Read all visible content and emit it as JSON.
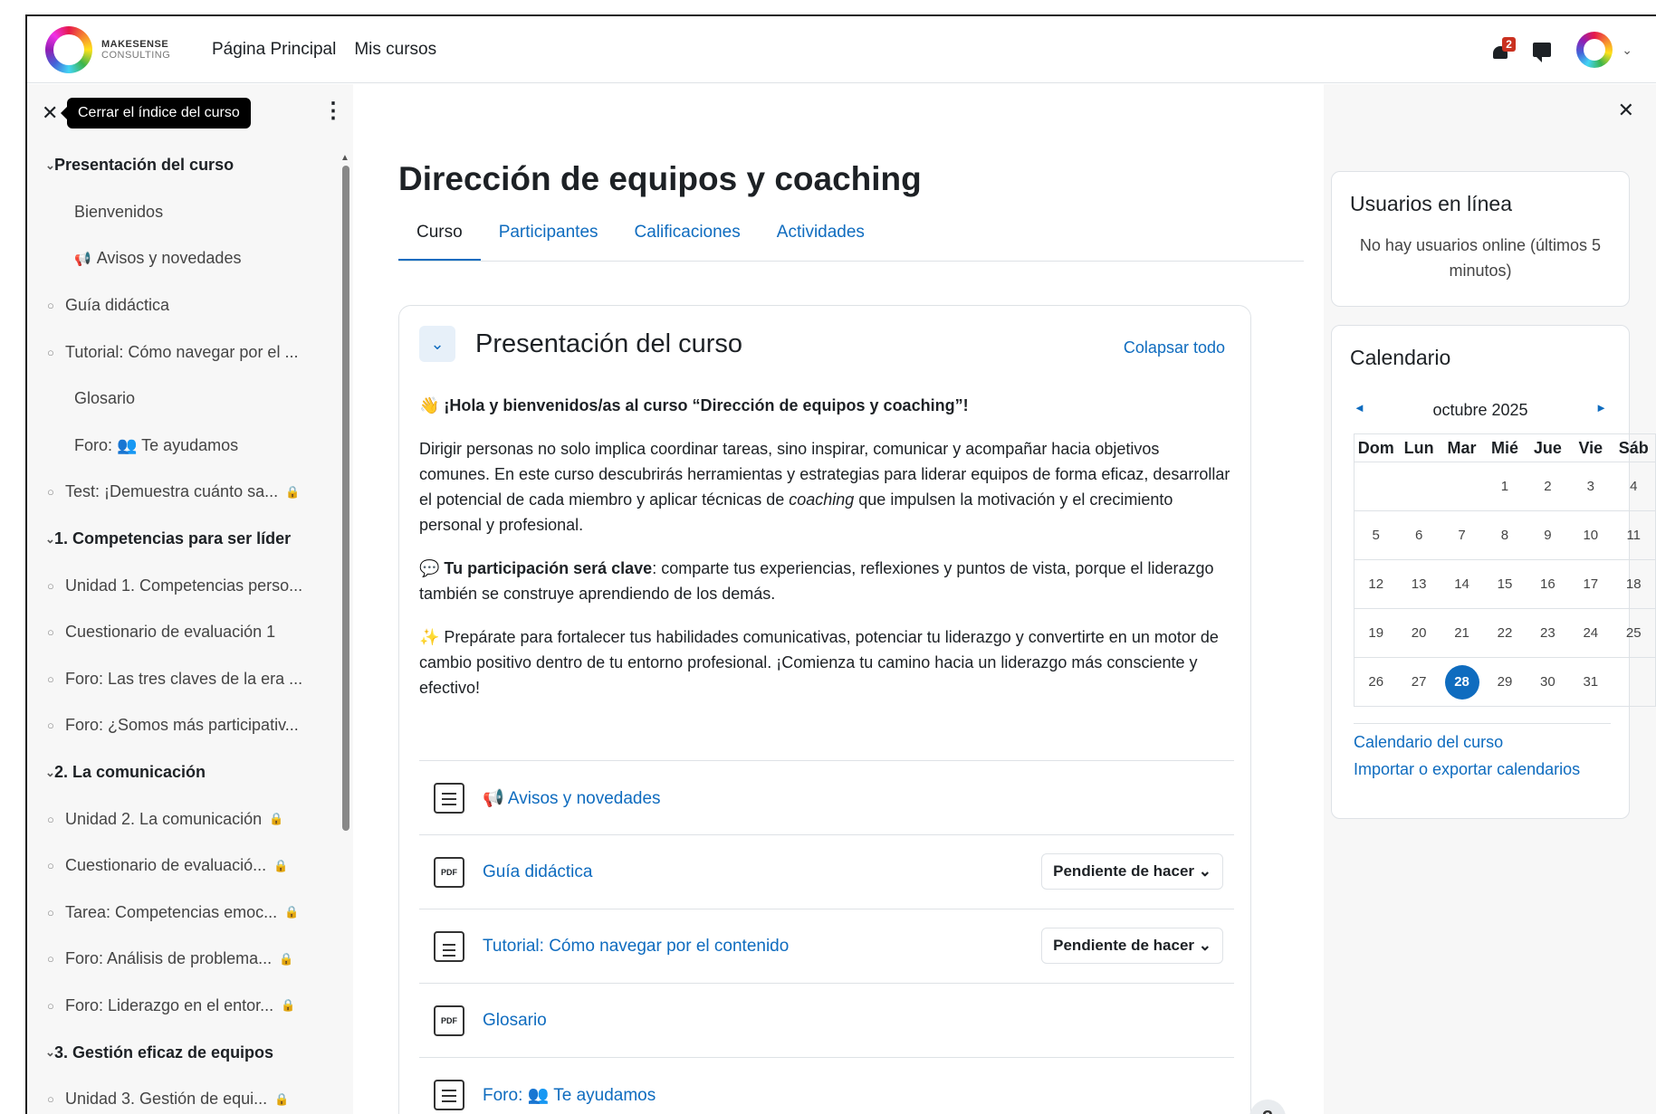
{
  "navbar": {
    "logo_line1": "MAKESENSE",
    "logo_line2": "CONSULTING",
    "links": [
      "Página Principal",
      "Mis cursos"
    ],
    "notifications_count": "2"
  },
  "course_index": {
    "close_tooltip": "Cerrar el índice del curso",
    "items": [
      {
        "type": "section",
        "label": "Presentación del curso"
      },
      {
        "type": "plain",
        "label": "Bienvenidos"
      },
      {
        "type": "plain",
        "label": "Avisos y novedades",
        "emoji": "📢"
      },
      {
        "type": "activity",
        "label": "Guía didáctica"
      },
      {
        "type": "activity",
        "label": "Tutorial: Cómo navegar por el ..."
      },
      {
        "type": "plain",
        "label": "Glosario"
      },
      {
        "type": "plain",
        "label": "Foro: 👥 Te ayudamos"
      },
      {
        "type": "activity",
        "label": "Test: ¡Demuestra cuánto sa...",
        "locked": true
      },
      {
        "type": "section",
        "label": "1. Competencias para ser líder"
      },
      {
        "type": "activity",
        "label": "Unidad 1. Competencias perso..."
      },
      {
        "type": "activity",
        "label": "Cuestionario de evaluación 1"
      },
      {
        "type": "activity",
        "label": "Foro: Las tres claves de la era ..."
      },
      {
        "type": "activity",
        "label": "Foro: ¿Somos más participativ..."
      },
      {
        "type": "section",
        "label": "2. La comunicación"
      },
      {
        "type": "activity",
        "label": "Unidad 2. La comunicación",
        "locked": true
      },
      {
        "type": "activity",
        "label": "Cuestionario de evaluació...",
        "locked": true
      },
      {
        "type": "activity",
        "label": "Tarea: Competencias emoc...",
        "locked": true
      },
      {
        "type": "activity",
        "label": "Foro: Análisis de problema...",
        "locked": true
      },
      {
        "type": "activity",
        "label": "Foro: Liderazgo en el entor...",
        "locked": true
      },
      {
        "type": "section",
        "label": "3. Gestión eficaz de equipos"
      },
      {
        "type": "activity",
        "label": "Unidad 3. Gestión de equi...",
        "locked": true
      }
    ]
  },
  "main": {
    "title": "Dirección de equipos y coaching",
    "tabs": [
      "Curso",
      "Participantes",
      "Calificaciones",
      "Actividades"
    ],
    "section": {
      "title": "Presentación del curso",
      "collapse_all": "Colapsar todo",
      "heading": "👋 ¡Hola y bienvenidos/as al curso “Dirección de equipos y coaching”!",
      "para1_a": "Dirigir personas no solo implica coordinar tareas, sino inspirar, comunicar y acompañar hacia objetivos comunes. En este curso descubrirás herramientas y estrategias para liderar equipos de forma eficaz, desarrollar el potencial de cada miembro y aplicar técnicas de ",
      "para1_em": "coaching",
      "para1_b": " que impulsen la motivación y el crecimiento personal y profesional.",
      "para2_bold": "Tu participación será clave",
      "para2_rest": ": comparte tus experiencias, reflexiones y puntos de vista, porque el liderazgo también se construye aprendiendo de los demás.",
      "para3": "✨ Prepárate para fortalecer tus habilidades comunicativas, potenciar tu liderazgo y convertirte en un motor de cambio positivo dentro de tu entorno profesional. ¡Comienza tu camino hacia un liderazgo más consciente y efectivo!",
      "activities": [
        {
          "icon": "forum",
          "name": "📢 Avisos y novedades",
          "status": ""
        },
        {
          "icon": "pdf",
          "name": "Guía didáctica",
          "status": "Pendiente de hacer"
        },
        {
          "icon": "doc",
          "name": "Tutorial: Cómo navegar por el contenido",
          "status": "Pendiente de hacer"
        },
        {
          "icon": "pdf",
          "name": "Glosario",
          "status": ""
        },
        {
          "icon": "forum",
          "name": "Foro: 👥 Te ayudamos",
          "status": ""
        }
      ]
    },
    "help": "?"
  },
  "right_drawer": {
    "online_block": {
      "title": "Usuarios en línea",
      "text": "No hay usuarios online (últimos 5 minutos)"
    },
    "calendar": {
      "title": "Calendario",
      "month": "octubre 2025",
      "days": [
        "Dom",
        "Lun",
        "Mar",
        "Mié",
        "Jue",
        "Vie",
        "Sáb"
      ],
      "weeks": [
        [
          "",
          "",
          "",
          "1",
          "2",
          "3",
          "4"
        ],
        [
          "5",
          "6",
          "7",
          "8",
          "9",
          "10",
          "11"
        ],
        [
          "12",
          "13",
          "14",
          "15",
          "16",
          "17",
          "18"
        ],
        [
          "19",
          "20",
          "21",
          "22",
          "23",
          "24",
          "25"
        ],
        [
          "26",
          "27",
          "28",
          "29",
          "30",
          "31",
          ""
        ]
      ],
      "today": "28",
      "links": [
        "Calendario del curso",
        "Importar o exportar calendarios"
      ]
    }
  }
}
